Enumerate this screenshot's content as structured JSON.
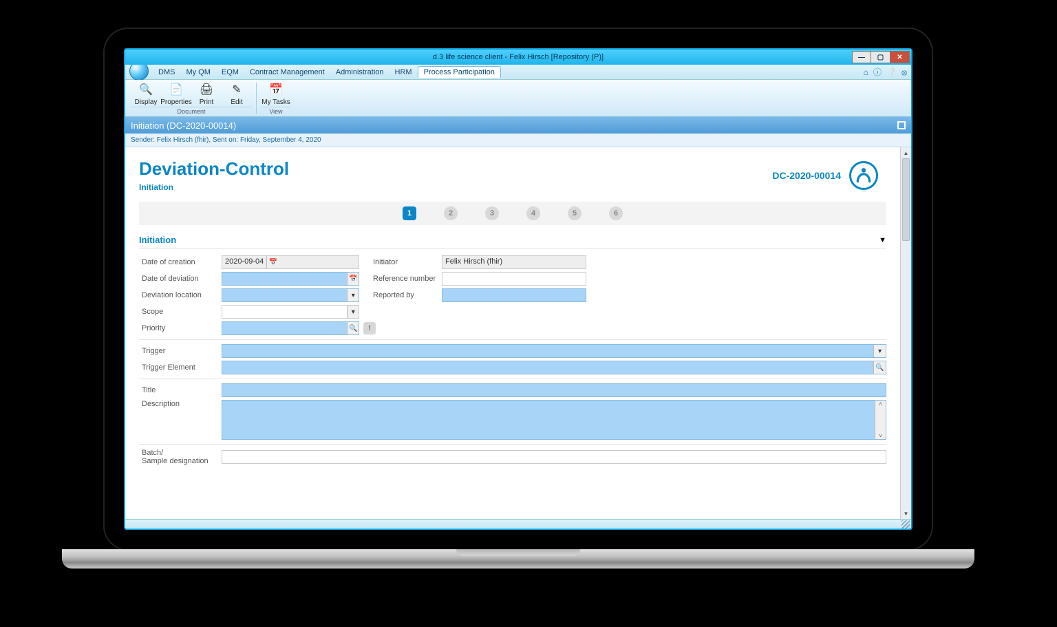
{
  "titlebar": {
    "title": "d.3 life science client - Felix Hirsch [Repository (P)]"
  },
  "window_buttons": {
    "minimize": "—",
    "maximize": "▢",
    "close": "✕"
  },
  "menu": {
    "tabs": [
      "DMS",
      "My QM",
      "EQM",
      "Contract Management",
      "Administration",
      "HRM",
      "Process Participation"
    ],
    "active_index": 6
  },
  "ribbon": {
    "groups": [
      {
        "name": "Document",
        "items": [
          {
            "label": "Display",
            "icon": "🔍"
          },
          {
            "label": "Properties",
            "icon": "📄"
          },
          {
            "label": "Print",
            "icon": "🖨"
          },
          {
            "label": "Edit",
            "icon": "✎"
          }
        ]
      },
      {
        "name": "View",
        "items": [
          {
            "label": "My Tasks",
            "icon": "📅"
          }
        ]
      }
    ]
  },
  "doc_title": "Initiation (DC-2020-00014)",
  "sender_line": "Sender: Felix Hirsch (fhir), Sent on: Friday, September 4, 2020",
  "header": {
    "title": "Deviation-Control",
    "subtitle": "Initiation",
    "doc_number": "DC-2020-00014"
  },
  "stepper": {
    "steps": [
      "1",
      "2",
      "3",
      "4",
      "5",
      "6"
    ],
    "active": 0
  },
  "section": {
    "title": "Initiation"
  },
  "fields": {
    "date_of_creation": {
      "label": "Date of creation",
      "value": "2020-09-04"
    },
    "initiator": {
      "label": "Initiator",
      "value": "Felix Hirsch (fhir)"
    },
    "date_of_deviation": {
      "label": "Date of deviation",
      "value": ""
    },
    "reference_number": {
      "label": "Reference number",
      "value": ""
    },
    "deviation_location": {
      "label": "Deviation location",
      "value": ""
    },
    "reported_by": {
      "label": "Reported by",
      "value": ""
    },
    "scope": {
      "label": "Scope",
      "value": ""
    },
    "priority": {
      "label": "Priority",
      "value": ""
    },
    "trigger": {
      "label": "Trigger",
      "value": ""
    },
    "trigger_element": {
      "label": "Trigger Element",
      "value": ""
    },
    "title": {
      "label": "Title",
      "value": ""
    },
    "description": {
      "label": "Description",
      "value": ""
    },
    "batch": {
      "label": "Batch/\nSample designation",
      "value": ""
    }
  }
}
